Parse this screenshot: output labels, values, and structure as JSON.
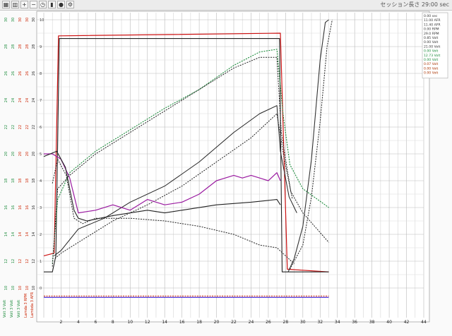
{
  "toolbar": {
    "session_time": "セッション長さ 29:00 sec",
    "buttons": [
      {
        "name": "grid-icon",
        "glyph": "▦"
      },
      {
        "name": "chart-icon",
        "glyph": "▥"
      },
      {
        "name": "zoom-in-icon",
        "glyph": "+"
      },
      {
        "name": "zoom-out-icon",
        "glyph": "−"
      },
      {
        "name": "clock-icon",
        "glyph": "◷"
      },
      {
        "name": "marker-icon",
        "glyph": "▮"
      },
      {
        "name": "pin-icon",
        "glyph": "●"
      },
      {
        "name": "settings-icon",
        "glyph": "⚙"
      }
    ]
  },
  "legend": [
    {
      "text": "0.00 sec",
      "color": "#333333"
    },
    {
      "text": "11.00 AFR",
      "color": "#333333"
    },
    {
      "text": "11.40 AFR",
      "color": "#333333"
    },
    {
      "text": "0.00 RPM",
      "color": "#333333"
    },
    {
      "text": "29.0 RPM",
      "color": "#333333"
    },
    {
      "text": "0.85 Volt",
      "color": "#333333"
    },
    {
      "text": "0.00 Volt",
      "color": "#333333"
    },
    {
      "text": "21.00 Volt",
      "color": "#333333"
    },
    {
      "text": "0.00 Volt",
      "color": "#1a8a3a"
    },
    {
      "text": "12.73 Volt",
      "color": "#1a8a3a"
    },
    {
      "text": "0.00 Volt",
      "color": "#1a8a3a"
    },
    {
      "text": "0.07 Volt",
      "color": "#aa3300"
    },
    {
      "text": "0.00 Volt",
      "color": "#aa3300"
    },
    {
      "text": "0.00 Volt",
      "color": "#aa3300"
    }
  ],
  "y_axes_labels": [
    "Volt 3 Volt",
    "Volt 3 Volt",
    "Volt 3 Volt",
    "Lamda 3 RPM",
    "Lambda 3 AFR"
  ],
  "chart_data": {
    "type": "line",
    "xlim": [
      0,
      44
    ],
    "ylim": [
      0,
      10
    ],
    "x_ticks": [
      "2",
      "4",
      "6",
      "8",
      "10",
      "12",
      "14",
      "16",
      "18",
      "20",
      "22",
      "24",
      "26",
      "28",
      "30",
      "32",
      "34",
      "36",
      "38",
      "40",
      "42",
      "44"
    ],
    "right_axis_ticks": [
      "0",
      "1",
      "2",
      "3",
      "4",
      "5",
      "6",
      "7",
      "8",
      "9",
      "10"
    ],
    "left_axis_columns": [
      {
        "color": "#1a8a3a",
        "ticks": [
          "10",
          "12",
          "14",
          "16",
          "18",
          "20",
          "22",
          "24",
          "26",
          "28",
          "30"
        ]
      },
      {
        "color": "#1a8a3a",
        "ticks": [
          "10",
          "12",
          "14",
          "16",
          "18",
          "20",
          "22",
          "24",
          "26",
          "28",
          "30"
        ]
      },
      {
        "color": "#cc2200",
        "ticks": [
          "10",
          "12",
          "14",
          "16",
          "18",
          "20",
          "22",
          "24",
          "26",
          "28",
          "30"
        ]
      },
      {
        "color": "#cc2200",
        "ticks": [
          "10",
          "12",
          "14",
          "16",
          "18",
          "20",
          "22",
          "24",
          "26",
          "28",
          "30"
        ]
      },
      {
        "color": "#222222",
        "ticks": [
          "10",
          "12",
          "14",
          "16",
          "18",
          "20",
          "22",
          "24",
          "26",
          "28",
          "30"
        ]
      }
    ],
    "series": [
      {
        "color": "#cc1111",
        "style": "solid",
        "width": 1.2,
        "points": [
          [
            0,
            1.2
          ],
          [
            1.2,
            1.3
          ],
          [
            1.7,
            9.4
          ],
          [
            27.4,
            9.5
          ],
          [
            28.2,
            0.7
          ],
          [
            33,
            0.6
          ]
        ]
      },
      {
        "color": "#222222",
        "style": "solid",
        "width": 1.1,
        "points": [
          [
            0,
            0.6
          ],
          [
            1,
            0.6
          ],
          [
            1.4,
            1.2
          ],
          [
            1.8,
            9.3
          ],
          [
            27.3,
            9.3
          ],
          [
            27.6,
            0.6
          ],
          [
            33,
            0.6
          ]
        ]
      },
      {
        "color": "#1a8a3a",
        "style": "dashed",
        "width": 1.1,
        "points": [
          [
            1,
            0.9
          ],
          [
            1.6,
            3.3
          ],
          [
            3,
            4.3
          ],
          [
            6,
            5.1
          ],
          [
            10,
            5.9
          ],
          [
            14,
            6.7
          ],
          [
            18,
            7.4
          ],
          [
            22,
            8.3
          ],
          [
            25,
            8.8
          ],
          [
            27,
            8.9
          ],
          [
            27.7,
            6.5
          ],
          [
            28.5,
            4.6
          ],
          [
            30,
            3.7
          ],
          [
            33,
            3.0
          ]
        ]
      },
      {
        "color": "#222222",
        "style": "dashed",
        "width": 1.0,
        "points": [
          [
            1,
            0.8
          ],
          [
            1.6,
            3.7
          ],
          [
            3,
            4.2
          ],
          [
            6,
            5.0
          ],
          [
            10,
            5.8
          ],
          [
            14,
            6.6
          ],
          [
            18,
            7.4
          ],
          [
            22,
            8.2
          ],
          [
            25,
            8.6
          ],
          [
            27,
            8.6
          ],
          [
            27.5,
            5.8
          ],
          [
            28.6,
            3.6
          ],
          [
            30,
            2.8
          ],
          [
            33,
            1.7
          ]
        ]
      },
      {
        "color": "#222222",
        "style": "solid",
        "width": 1.0,
        "points": [
          [
            1.2,
            1.2
          ],
          [
            2,
            1.4
          ],
          [
            4,
            2.2
          ],
          [
            7,
            2.6
          ],
          [
            10,
            3.2
          ],
          [
            14,
            3.8
          ],
          [
            18,
            4.7
          ],
          [
            22,
            5.8
          ],
          [
            25,
            6.5
          ],
          [
            27,
            6.8
          ],
          [
            27.4,
            5.1
          ],
          [
            28.4,
            3.4
          ],
          [
            29.3,
            2.8
          ]
        ]
      },
      {
        "color": "#222222",
        "style": "dashed",
        "width": 1.0,
        "points": [
          [
            1.3,
            1.1
          ],
          [
            2,
            1.3
          ],
          [
            5,
            1.9
          ],
          [
            8,
            2.5
          ],
          [
            12,
            3.1
          ],
          [
            16,
            3.8
          ],
          [
            20,
            4.7
          ],
          [
            24,
            5.6
          ],
          [
            27,
            6.5
          ],
          [
            27.8,
            4.9
          ],
          [
            28.8,
            3.3
          ]
        ]
      },
      {
        "color": "#9a1aa0",
        "style": "solid",
        "width": 1.2,
        "points": [
          [
            0,
            5.0
          ],
          [
            1,
            5.0
          ],
          [
            2,
            4.8
          ],
          [
            3,
            4.1
          ],
          [
            4,
            2.8
          ],
          [
            6,
            2.9
          ],
          [
            8,
            3.1
          ],
          [
            10,
            2.9
          ],
          [
            12,
            3.3
          ],
          [
            14,
            3.1
          ],
          [
            16,
            3.2
          ],
          [
            18,
            3.5
          ],
          [
            20,
            4.0
          ],
          [
            22,
            4.2
          ],
          [
            23,
            4.1
          ],
          [
            24,
            4.2
          ],
          [
            25,
            4.1
          ],
          [
            26,
            4.0
          ],
          [
            27,
            4.3
          ],
          [
            27.4,
            4.0
          ]
        ]
      },
      {
        "color": "#222222",
        "style": "solid",
        "width": 1.1,
        "points": [
          [
            0,
            4.9
          ],
          [
            1.5,
            5.1
          ],
          [
            2.5,
            4.5
          ],
          [
            3.5,
            2.9
          ],
          [
            4,
            2.6
          ],
          [
            5,
            2.5
          ],
          [
            8,
            2.7
          ],
          [
            12,
            2.9
          ],
          [
            14,
            2.8
          ],
          [
            16,
            2.9
          ],
          [
            20,
            3.1
          ],
          [
            24,
            3.2
          ],
          [
            27,
            3.3
          ],
          [
            27.4,
            3.1
          ]
        ]
      },
      {
        "color": "#222222",
        "style": "dashed",
        "width": 1.0,
        "points": [
          [
            1,
            3.9
          ],
          [
            1.6,
            4.8
          ],
          [
            2.6,
            4.2
          ],
          [
            3.5,
            2.6
          ],
          [
            4.5,
            2.4
          ],
          [
            6,
            2.6
          ],
          [
            10,
            2.6
          ],
          [
            14,
            2.5
          ],
          [
            18,
            2.3
          ],
          [
            22,
            2.0
          ],
          [
            25,
            1.6
          ],
          [
            27,
            1.5
          ],
          [
            28,
            1.2
          ],
          [
            29,
            0.9
          ]
        ]
      },
      {
        "color": "#333333",
        "style": "solid",
        "width": 1.1,
        "points": [
          [
            28.3,
            0.6
          ],
          [
            29,
            1.1
          ],
          [
            30,
            2.3
          ],
          [
            31,
            4.8
          ],
          [
            32,
            8.5
          ],
          [
            32.6,
            9.9
          ],
          [
            33,
            10
          ]
        ]
      },
      {
        "color": "#222222",
        "style": "dashed",
        "width": 1.0,
        "points": [
          [
            28.5,
            0.7
          ],
          [
            30,
            1.6
          ],
          [
            31,
            3.4
          ],
          [
            32,
            6.2
          ],
          [
            32.8,
            9.0
          ],
          [
            33.4,
            10
          ]
        ]
      },
      {
        "color": "#2200cc",
        "style": "solid",
        "width": 1.0,
        "points": [
          [
            0,
            -0.35
          ],
          [
            33,
            -0.35
          ]
        ]
      },
      {
        "color": "#cc2200",
        "style": "dashed",
        "width": 1.0,
        "points": [
          [
            0,
            -0.3
          ],
          [
            33,
            -0.3
          ]
        ]
      }
    ]
  }
}
